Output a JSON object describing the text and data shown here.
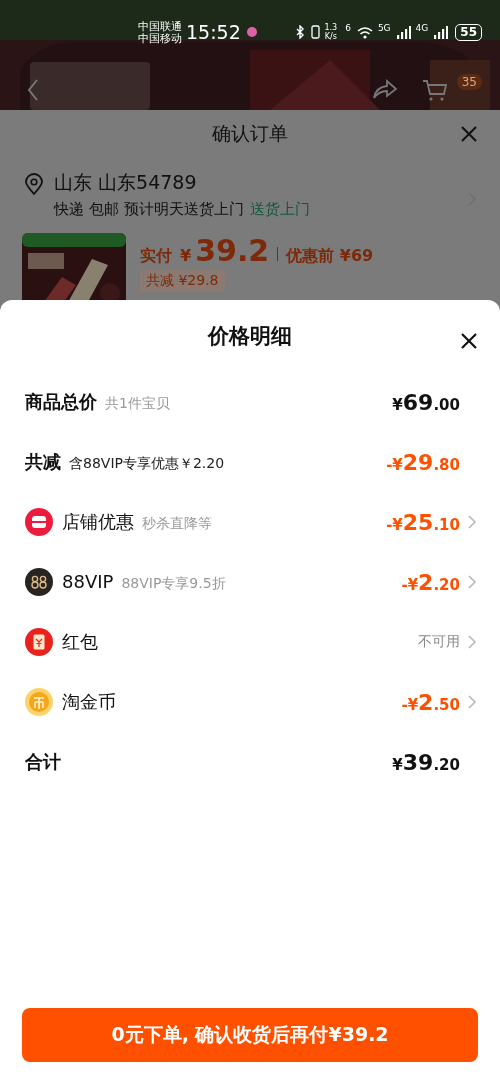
{
  "status_bar": {
    "carriers": [
      "中国联通",
      "中国移动"
    ],
    "time": "15:52",
    "speed_value": "1.3",
    "speed_unit": "K/s",
    "network_labels": [
      "6",
      "5G",
      "4G"
    ],
    "battery": "55"
  },
  "top_bar": {
    "cart_badge": "35"
  },
  "order_sheet": {
    "title": "确认订单",
    "address": "山东 山东54789",
    "delivery": "快递 包邮 预计明天送货上门",
    "delivery_link": "送货上门",
    "paid_label": "实付",
    "paid_currency": "¥",
    "paid_amount": "39.2",
    "before_label": "优惠前 ¥69",
    "saved": "共减 ¥29.8"
  },
  "price_detail": {
    "title": "价格明细",
    "rows": [
      {
        "kind": "total",
        "label": "商品总价",
        "note": "共1件宝贝",
        "amount": "¥69.00",
        "discount": false,
        "available": true,
        "arrow": false
      },
      {
        "kind": "savings",
        "label": "共减",
        "note": "含88VIP专享优惠￥2.20",
        "amount": "-¥29.80",
        "discount": true,
        "available": true,
        "arrow": false
      },
      {
        "kind": "store",
        "label": "店铺优惠",
        "note": "秒杀直降等",
        "amount": "-¥25.10",
        "discount": true,
        "available": true,
        "arrow": true
      },
      {
        "kind": "vip",
        "label": "88VIP",
        "note": "88VIP专享9.5折",
        "amount": "-¥2.20",
        "discount": true,
        "available": true,
        "arrow": true
      },
      {
        "kind": "packet",
        "label": "红包",
        "amount": "不可用",
        "discount": false,
        "available": false,
        "arrow": true
      },
      {
        "kind": "coin",
        "label": "淘金币",
        "amount": "-¥2.50",
        "discount": true,
        "available": true,
        "arrow": true
      },
      {
        "kind": "total",
        "label": "合计",
        "amount": "¥39.20",
        "discount": false,
        "available": true,
        "arrow": false
      }
    ]
  },
  "submit_button": {
    "label": "0元下单, 确认收货后再付¥39.2"
  }
}
